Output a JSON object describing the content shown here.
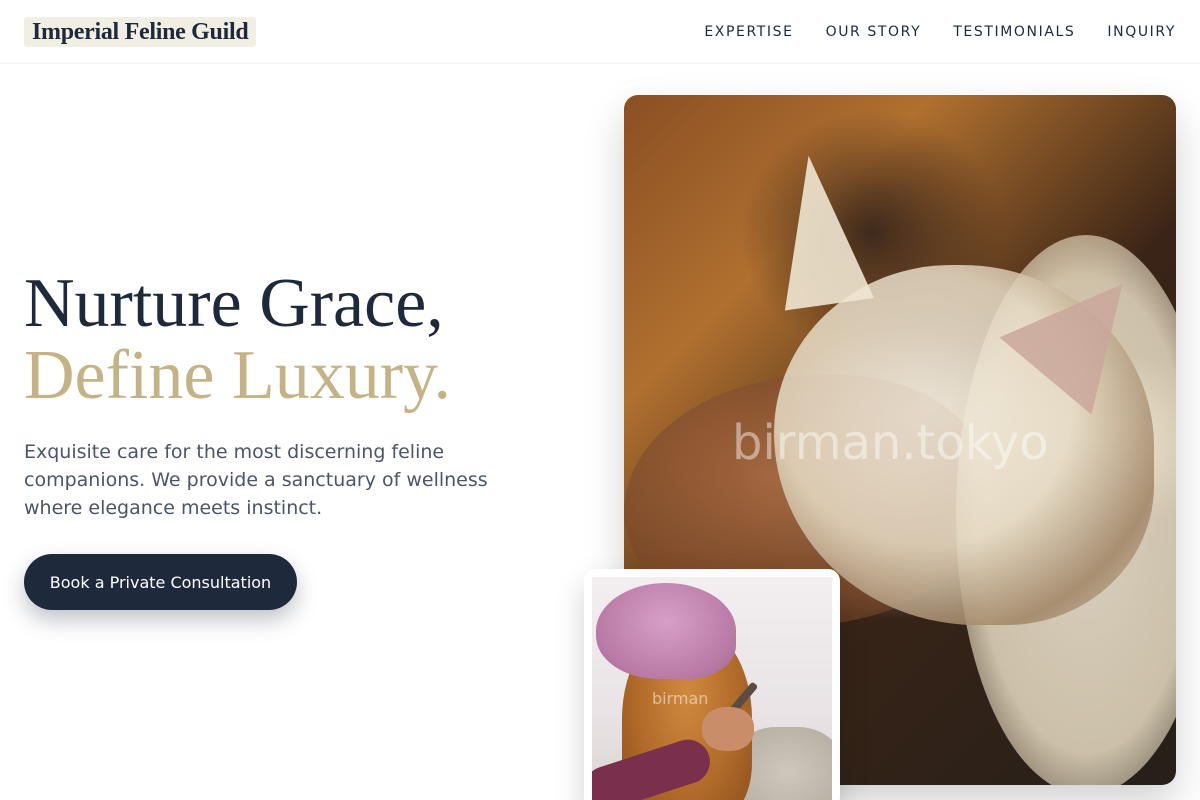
{
  "nav": {
    "logo": "Imperial Feline Guild",
    "links": [
      "EXPERTISE",
      "OUR STORY",
      "TESTIMONIALS",
      "INQUIRY"
    ]
  },
  "hero": {
    "title_line1": "Nurture Grace,",
    "title_line2": "Define Luxury.",
    "description": "Exquisite care for the most discerning feline companions. We provide a sanctuary of wellness where elegance meets instinct.",
    "cta_label": "Book a Private Consultation"
  },
  "images": {
    "main_watermark": "birman.tokyo",
    "card_watermark": "birman"
  },
  "colors": {
    "primary": "#1e293b",
    "accent_gold": "#c5b388",
    "logo_bg": "#f1efe4",
    "body_text": "#4a5568"
  }
}
